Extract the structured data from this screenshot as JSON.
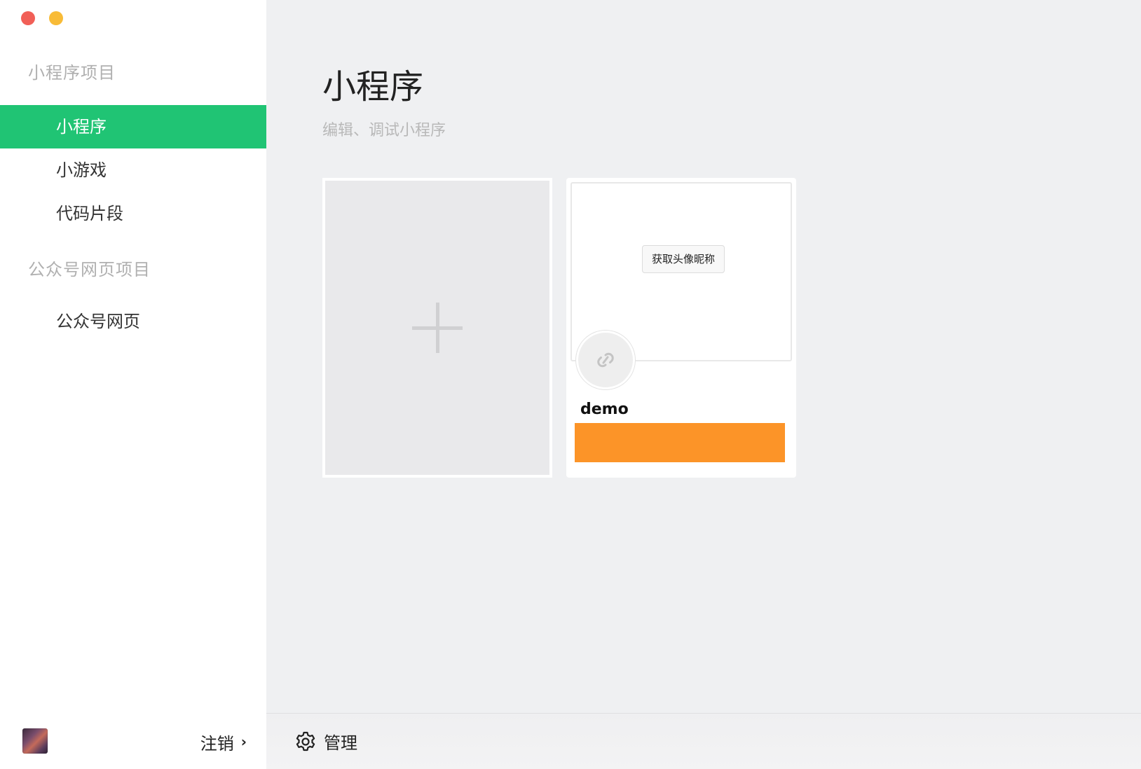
{
  "window": {
    "controls": [
      "close",
      "minimize"
    ]
  },
  "sidebar": {
    "sections": [
      {
        "title": "小程序项目",
        "items": [
          {
            "label": "小程序",
            "active": true
          },
          {
            "label": "小游戏",
            "active": false
          },
          {
            "label": "代码片段",
            "active": false
          }
        ]
      },
      {
        "title": "公众号网页项目",
        "items": [
          {
            "label": "公众号网页",
            "active": false
          }
        ]
      }
    ],
    "footer": {
      "logout_label": "注销",
      "logout_icon": "chevron-right-icon"
    }
  },
  "main": {
    "title": "小程序",
    "subtitle": "编辑、调试小程序",
    "new_project_icon": "plus-icon",
    "projects": [
      {
        "name": "demo",
        "preview_button_label": "获取头像昵称",
        "icon": "link-icon",
        "bar_color": "#fc9428"
      }
    ],
    "footer": {
      "manage_label": "管理",
      "manage_icon": "gear-icon"
    }
  },
  "colors": {
    "accent": "#20c474",
    "close": "#f15f57",
    "minimize": "#f8bb37"
  }
}
